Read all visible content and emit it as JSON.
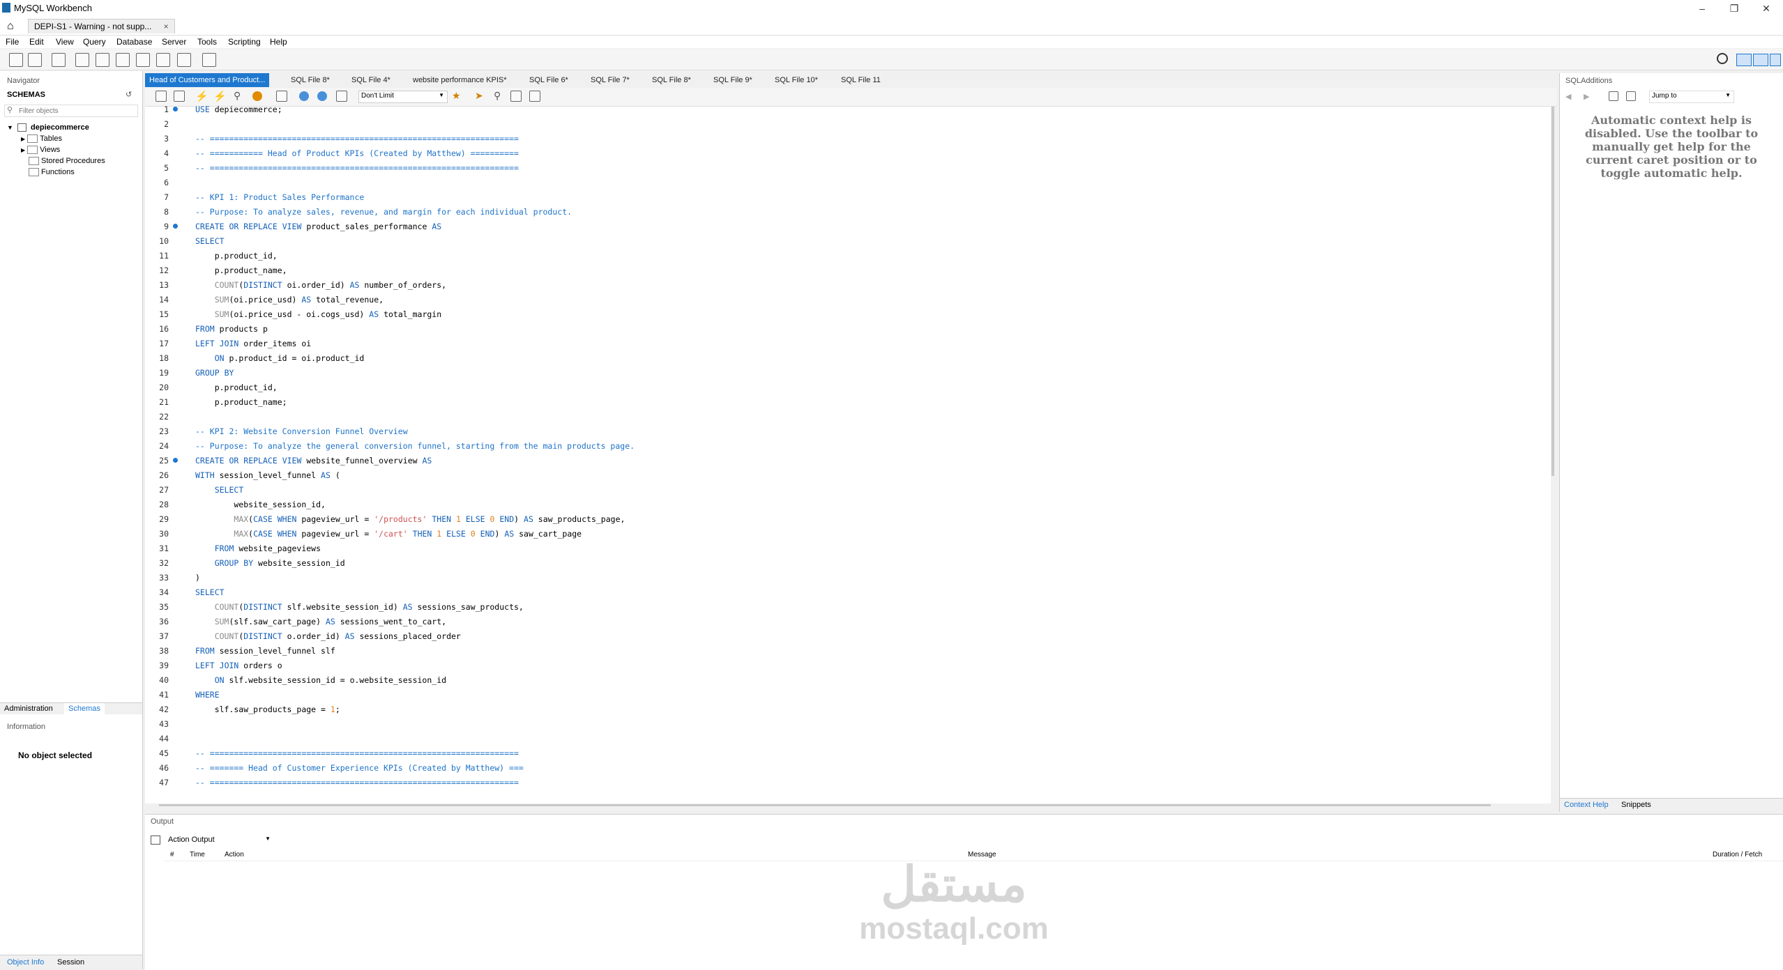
{
  "window": {
    "title": "MySQL Workbench",
    "connection_tab": "DEPI-S1 - Warning - not supp..."
  },
  "menu": [
    "File",
    "Edit",
    "View",
    "Query",
    "Database",
    "Server",
    "Tools",
    "Scripting",
    "Help"
  ],
  "navigator": {
    "header": "Navigator",
    "schemas_label": "SCHEMAS",
    "filter_placeholder": "Filter objects",
    "schema": "depiecommerce",
    "children": [
      "Tables",
      "Views",
      "Stored Procedures",
      "Functions"
    ],
    "bottom_tabs": [
      "Administration",
      "Schemas"
    ],
    "information_label": "Information",
    "no_object": "No object selected",
    "footer_tabs": [
      "Object Info",
      "Session"
    ]
  },
  "editor_tabs": [
    "Head of Customers and Product...",
    "SQL File 8*",
    "SQL File 4*",
    "website performance KPIS*",
    "SQL File 6*",
    "SQL File 7*",
    "SQL File 8*",
    "SQL File 9*",
    "SQL File 10*",
    "SQL File 11"
  ],
  "limit_select": "Don't Limit",
  "code_lines": [
    "USE depiecommerce;",
    "",
    "-- ================================================================",
    "-- =========== Head of Product KPIs (Created by Matthew) ==========",
    "-- ================================================================",
    "",
    "-- KPI 1: Product Sales Performance",
    "-- Purpose: To analyze sales, revenue, and margin for each individual product.",
    "CREATE OR REPLACE VIEW product_sales_performance AS",
    "SELECT",
    "    p.product_id,",
    "    p.product_name,",
    "    COUNT(DISTINCT oi.order_id) AS number_of_orders,",
    "    SUM(oi.price_usd) AS total_revenue,",
    "    SUM(oi.price_usd - oi.cogs_usd) AS total_margin",
    "FROM products p",
    "LEFT JOIN order_items oi",
    "    ON p.product_id = oi.product_id",
    "GROUP BY",
    "    p.product_id,",
    "    p.product_name;",
    "",
    "-- KPI 2: Website Conversion Funnel Overview",
    "-- Purpose: To analyze the general conversion funnel, starting from the main products page.",
    "CREATE OR REPLACE VIEW website_funnel_overview AS",
    "WITH session_level_funnel AS (",
    "    SELECT",
    "        website_session_id,",
    "        MAX(CASE WHEN pageview_url = '/products' THEN 1 ELSE 0 END) AS saw_products_page,",
    "        MAX(CASE WHEN pageview_url = '/cart' THEN 1 ELSE 0 END) AS saw_cart_page",
    "    FROM website_pageviews",
    "    GROUP BY website_session_id",
    ")",
    "SELECT",
    "    COUNT(DISTINCT slf.website_session_id) AS sessions_saw_products,",
    "    SUM(slf.saw_cart_page) AS sessions_went_to_cart,",
    "    COUNT(DISTINCT o.order_id) AS sessions_placed_order",
    "FROM session_level_funnel slf",
    "LEFT JOIN orders o",
    "    ON slf.website_session_id = o.website_session_id",
    "WHERE",
    "    slf.saw_products_page = 1;",
    "",
    "",
    "-- ================================================================",
    "-- ======= Head of Customer Experience KPIs (Created by Matthew) ===",
    "-- ================================================================"
  ],
  "sql_additions": {
    "header": "SQLAdditions",
    "jump_to": "Jump to",
    "help_text": "Automatic context help is disabled. Use the toolbar to manually get help for the current caret position or to toggle automatic help.",
    "tabs": [
      "Context Help",
      "Snippets"
    ]
  },
  "output": {
    "header": "Output",
    "select": "Action Output",
    "columns": [
      "#",
      "Time",
      "Action",
      "Message",
      "Duration / Fetch"
    ]
  },
  "watermark": {
    "arabic": "مستقل",
    "latin": "mostaql.com"
  }
}
